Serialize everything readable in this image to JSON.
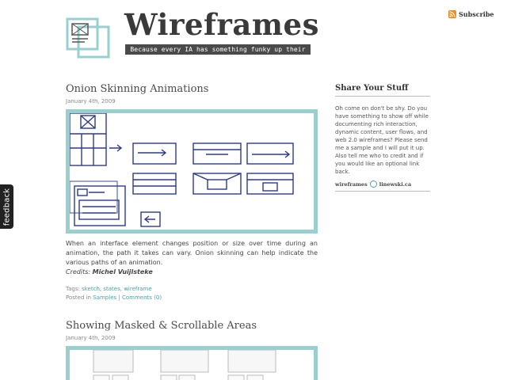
{
  "feedback": {
    "label": "feedback"
  },
  "subscribe": {
    "label": "Subscribe",
    "icon": "rss-icon",
    "icon_color": "#f28a1b"
  },
  "header": {
    "title": "Wireframes",
    "tagline": "Because every IA has something funky up their sleeve"
  },
  "posts": [
    {
      "title": "Onion Skinning Animations",
      "date": "January 4th, 2009",
      "body": "When an interface element changes position or size over time during an animation, the path it takes can vary. Onion skinning can help indicate the various paths of an animation.",
      "credits_label": "Credits:",
      "credits_name": "Michel Vuijlsteke",
      "tags_label": "Tags:",
      "tags": [
        "sketch",
        "states",
        "wireframe"
      ],
      "posted_label": "Posted in",
      "category": "Samples",
      "separator": "|",
      "comments": "Comments (0)"
    },
    {
      "title": "Showing Masked & Scrollable Areas",
      "date": "January 4th, 2009"
    }
  ],
  "sidebar": {
    "title": "Share Your Stuff",
    "text": "Oh come on don't be shy. Do you have something to show off while documenting rich interaction, dynamic content, user flows, and web 2.0 wireframes? Please send me a sample and I will put it up. Also tell me who to credit and if you would like an optional link back.",
    "credit_left": "wireframes",
    "credit_right": "linewski.ca"
  },
  "colors": {
    "accent": "#99cfcf",
    "link": "#4aa3a8",
    "sketch_ink": "#2c3a8c"
  }
}
